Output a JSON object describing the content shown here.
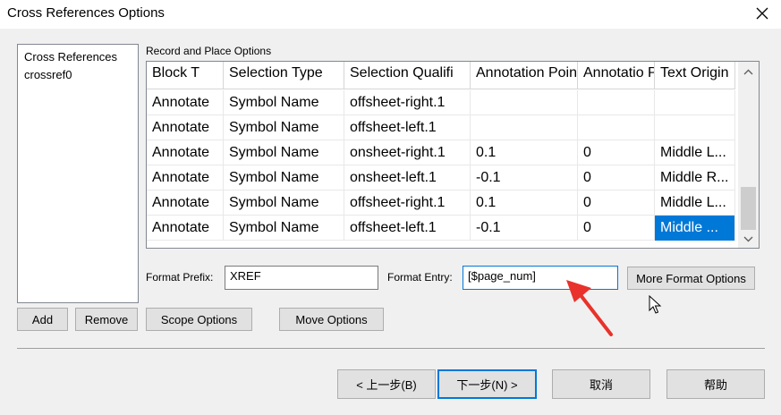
{
  "window": {
    "title": "Cross References Options",
    "close_icon": "close-icon"
  },
  "left_list": {
    "items": [
      "Cross References",
      "crossref0"
    ]
  },
  "record_group": {
    "label": "Record and Place Options",
    "columns": [
      "Block T",
      "Selection Type",
      "Selection Qualifi",
      "Annotation Point X",
      "Annotatio Point Y",
      "Text Origin"
    ],
    "rows": [
      [
        "Annotate",
        "Symbol Name",
        "offsheet-right.1",
        "",
        "",
        ""
      ],
      [
        "Annotate",
        "Symbol Name",
        "offsheet-left.1",
        "",
        "",
        ""
      ],
      [
        "Annotate",
        "Symbol Name",
        "onsheet-right.1",
        "0.1",
        "0",
        "Middle L..."
      ],
      [
        "Annotate",
        "Symbol Name",
        "onsheet-left.1",
        "-0.1",
        "0",
        "Middle R..."
      ],
      [
        "Annotate",
        "Symbol Name",
        "offsheet-right.1",
        "0.1",
        "0",
        "Middle L..."
      ],
      [
        "Annotate",
        "Symbol Name",
        "offsheet-left.1",
        "-0.1",
        "0",
        "Middle ..."
      ]
    ],
    "selected_cell": {
      "row": 5,
      "col": 5
    },
    "scroll_up_icon": "chevron-up-icon",
    "scroll_down_icon": "chevron-down-icon"
  },
  "format": {
    "prefix_label": "Format Prefix:",
    "prefix_value": "XREF",
    "entry_label": "Format Entry:",
    "entry_value": "[$page_num]",
    "more_button": "More Format Options"
  },
  "buttons": {
    "add": "Add",
    "remove": "Remove",
    "scope": "Scope Options",
    "move": "Move Options",
    "back": "< 上一步(B)",
    "next": "下一步(N) >",
    "cancel": "取消",
    "help": "帮助"
  },
  "colors": {
    "accent": "#0078d7",
    "annotation_arrow": "#e8322b"
  },
  "overlay": {
    "arrow_icon": "red-arrow-annotation",
    "cursor_icon": "mouse-cursor-icon"
  }
}
